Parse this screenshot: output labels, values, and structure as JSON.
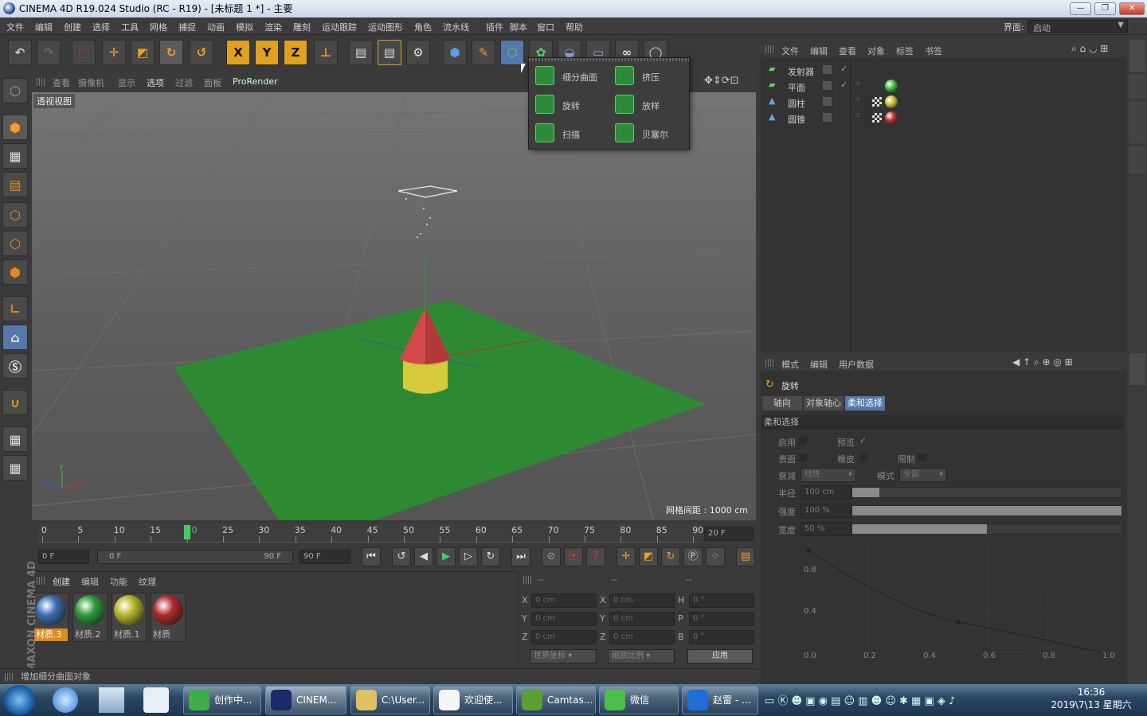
{
  "window": {
    "title": "CINEMA 4D R19.024 Studio (RC - R19) - [未标题 1 *] - 主要",
    "min": "—",
    "max": "❐",
    "close": "✕"
  },
  "menu": {
    "items": [
      "文件",
      "编辑",
      "创建",
      "选择",
      "工具",
      "网格",
      "捕捉",
      "动画",
      "模拟",
      "渲染",
      "雕刻",
      "运动跟踪",
      "运动图形",
      "角色",
      "流水线",
      "插件",
      "脚本",
      "窗口",
      "帮助"
    ],
    "layout_label": "界面:",
    "layout_value": "启动"
  },
  "toolbar": {
    "x": "X",
    "y": "Y",
    "z": "Z"
  },
  "viewport": {
    "menu": [
      "查看",
      "摄像机",
      "显示",
      "选项",
      "过滤",
      "面板",
      "ProRender"
    ],
    "label": "透视视图",
    "grid_spacing": "网格间距 : 1000 cm",
    "axis": {
      "x": "X",
      "y": "Y",
      "z": "Z"
    }
  },
  "popup": {
    "items": [
      {
        "label": "细分曲面",
        "icon": "subdivision-surface-icon"
      },
      {
        "label": "挤压",
        "icon": "extrude-icon"
      },
      {
        "label": "旋转",
        "icon": "lathe-icon"
      },
      {
        "label": "放样",
        "icon": "loft-icon"
      },
      {
        "label": "扫描",
        "icon": "sweep-icon"
      },
      {
        "label": "贝塞尔",
        "icon": "bezier-icon"
      }
    ]
  },
  "timeline": {
    "ticks": [
      "0",
      "5",
      "10",
      "15",
      "20",
      "25",
      "30",
      "35",
      "40",
      "45",
      "50",
      "55",
      "60",
      "65",
      "70",
      "75",
      "80",
      "85",
      "90"
    ],
    "current_frame": "20 F",
    "start": "0 F",
    "range_start": "0 F",
    "range_end": "90 F",
    "end": "90 F"
  },
  "materials": {
    "menu": [
      "创建",
      "编辑",
      "功能",
      "纹理"
    ],
    "items": [
      {
        "label": "材质.3",
        "color": "#3d6eb5"
      },
      {
        "label": "材质.2",
        "color": "#2f9a3a"
      },
      {
        "label": "材质.1",
        "color": "#b6b62a"
      },
      {
        "label": "材质",
        "color": "#b12a2a"
      }
    ],
    "logo": "MAXON CINEMA 4D"
  },
  "coords": {
    "header": [
      "--",
      "--",
      "--"
    ],
    "rows": [
      {
        "a": "X",
        "v1": "0 cm",
        "b": "X",
        "v2": "0 cm",
        "c": "H",
        "v3": "0 °"
      },
      {
        "a": "Y",
        "v1": "0 cm",
        "b": "Y",
        "v2": "0 cm",
        "c": "P",
        "v3": "0 °"
      },
      {
        "a": "Z",
        "v1": "0 cm",
        "b": "Z",
        "v2": "0 cm",
        "c": "B",
        "v3": "0 °"
      }
    ],
    "world": "世界坐标",
    "scale": "缩放比例",
    "apply": "应用"
  },
  "status": "增加细分曲面对象",
  "objects": {
    "menu": [
      "文件",
      "编辑",
      "查看",
      "对象",
      "标签",
      "书签"
    ],
    "items": [
      {
        "name": "发射器"
      },
      {
        "name": "平面"
      },
      {
        "name": "圆柱"
      },
      {
        "name": "圆锥"
      }
    ]
  },
  "attributes": {
    "menu": [
      "模式",
      "编辑",
      "用户数据"
    ],
    "tool": "旋转",
    "tabs": [
      "轴向",
      "对象轴心",
      "柔和选择"
    ],
    "section": "柔和选择",
    "enable": "启用",
    "preview": "预览",
    "surface": "表面",
    "rubber": "橡皮",
    "limit": "限制",
    "falloff": "衰减",
    "falloff_value": "线性",
    "mode": "模式",
    "mode_value": "全部",
    "radius": "半径",
    "radius_value": "100 cm",
    "strength": "强度",
    "strength_value": "100 %",
    "width": "宽度",
    "width_value": "50 %",
    "graph_y": [
      "0.8",
      "0.4"
    ],
    "graph_x": [
      "0.0",
      "0.2",
      "0.4",
      "0.6",
      "0.8",
      "1.0"
    ]
  },
  "taskbar": {
    "items": [
      "创作中...",
      "CINEM...",
      "C:\\User...",
      "欢迎使...",
      "Camtas...",
      "微信",
      "赵雷 - ..."
    ],
    "time": "16:36",
    "date": "2019\\7\\13 星期六"
  }
}
